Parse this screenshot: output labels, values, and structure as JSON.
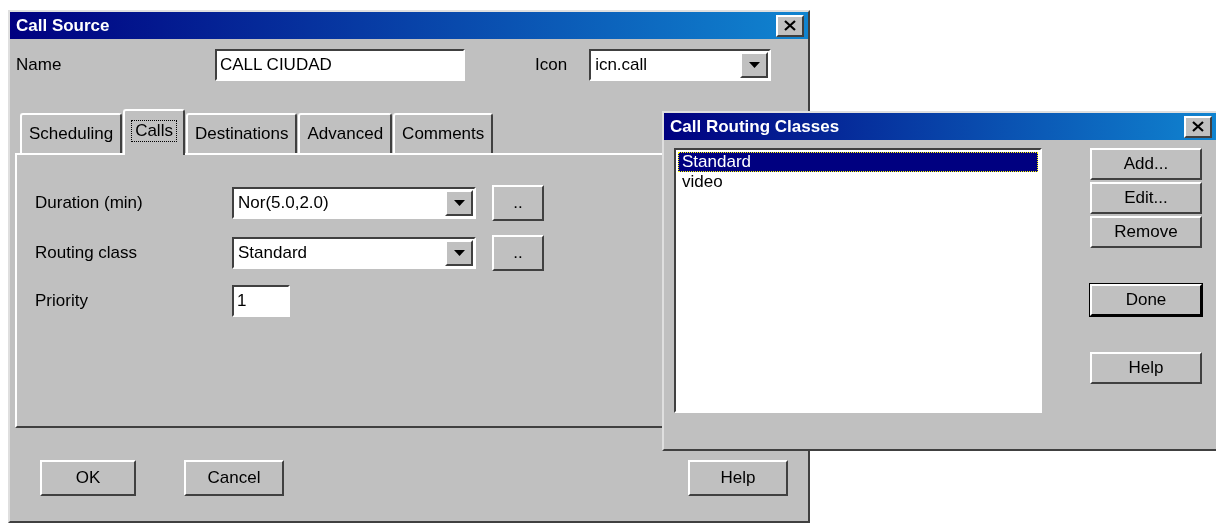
{
  "call_source": {
    "title": "Call Source",
    "name_field": {
      "label": "Name",
      "value": "CALL CIUDAD"
    },
    "icon_field": {
      "label": "Icon",
      "value": "icn.call"
    },
    "tabs": [
      {
        "label": "Scheduling",
        "selected": false
      },
      {
        "label": "Calls",
        "selected": true
      },
      {
        "label": "Destinations",
        "selected": false
      },
      {
        "label": "Advanced",
        "selected": false
      },
      {
        "label": "Comments",
        "selected": false
      }
    ],
    "fields": [
      {
        "kind": "dropdown",
        "label": "Duration (min)",
        "value": "Nor(5.0,2.0)",
        "browse": ".."
      },
      {
        "kind": "dropdown",
        "label": "Routing class",
        "value": "Standard",
        "browse": ".."
      },
      {
        "kind": "text",
        "label": "Priority",
        "value": "1"
      }
    ],
    "left_buttons": [
      "OK",
      "Cancel"
    ],
    "right_buttons": [
      "Help"
    ]
  },
  "routing_dialog": {
    "title": "Call Routing Classes",
    "items": [
      {
        "label": "Standard",
        "selected": true
      },
      {
        "label": "video",
        "selected": false
      }
    ],
    "button_groups": [
      [
        {
          "label": "Add...",
          "default": false
        },
        {
          "label": "Edit...",
          "default": false
        },
        {
          "label": "Remove",
          "default": false
        }
      ],
      [
        {
          "label": "Done",
          "default": true
        }
      ],
      [
        {
          "label": "Help",
          "default": false
        }
      ]
    ]
  }
}
